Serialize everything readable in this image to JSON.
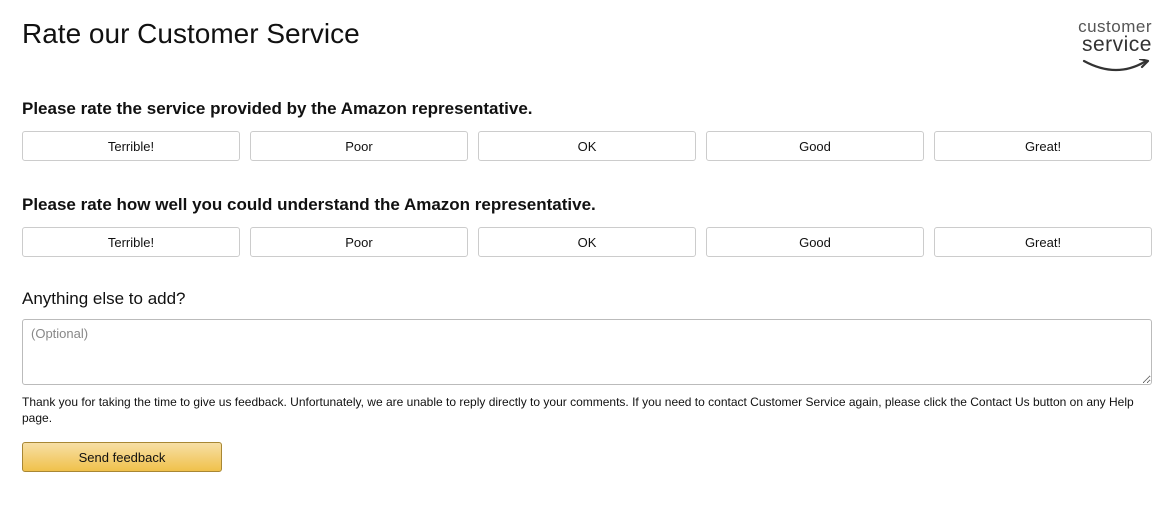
{
  "header": {
    "title": "Rate our Customer Service",
    "logo_line1": "customer",
    "logo_line2": "service"
  },
  "service_rating": {
    "prompt": "Please rate the service provided by the Amazon representative.",
    "options": [
      "Terrible!",
      "Poor",
      "OK",
      "Good",
      "Great!"
    ]
  },
  "understand_rating": {
    "prompt": "Please rate how well you could understand the Amazon representative.",
    "options": [
      "Terrible!",
      "Poor",
      "OK",
      "Good",
      "Great!"
    ]
  },
  "comment": {
    "prompt": "Anything else to add?",
    "placeholder": "(Optional)"
  },
  "note": "Thank you for taking the time to give us feedback. Unfortunately, we are unable to reply directly to your comments. If you need to contact Customer Service again, please click the Contact Us button on any Help page.",
  "submit_label": "Send feedback"
}
